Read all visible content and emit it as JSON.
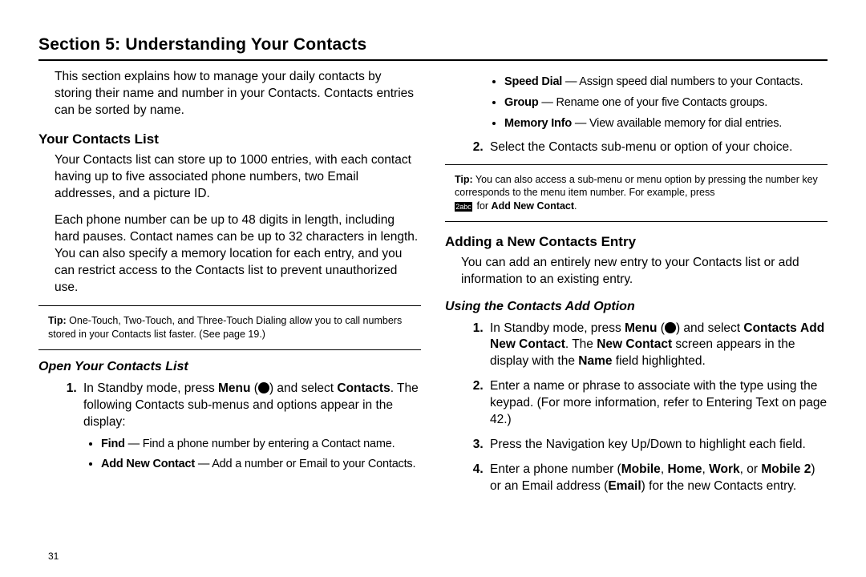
{
  "title": "Section 5: Understanding Your Contacts",
  "page_number": "31",
  "left": {
    "intro": "This section explains how to manage your daily contacts by storing their name and number in your Contacts. Contacts entries can be sorted by name.",
    "h_contacts_list": "Your Contacts List",
    "p1": "Your Contacts list can store up to 1000 entries, with each contact having up to five associated phone numbers, two Email addresses, and a picture ID.",
    "p2": "Each phone number can be up to 48 digits in length, including hard pauses. Contact names can be up to 32 characters in length. You can also specify a memory location for each entry, and you can restrict access to the Contacts list to prevent unauthorized use.",
    "tip_label": "Tip:",
    "tip_body": " One-Touch, Two-Touch, and Three-Touch Dialing allow you to call numbers stored in your Contacts list faster. (See page 19.)",
    "h_open": "Open Your Contacts List",
    "step1_a": "In Standby mode, press ",
    "step1_menu": "Menu",
    "step1_b": " (",
    "step1_c": ") and select ",
    "step1_contacts": "Contacts",
    "step1_d": ". The following Contacts sub-menus and options appear in the display:",
    "bul_find_t": "Find",
    "bul_find_d": " — Find a phone number by entering a Contact name.",
    "bul_add_t": "Add New Contact",
    "bul_add_d": " — Add a number or Email to your Contacts."
  },
  "right": {
    "bul_speed_t": "Speed Dial",
    "bul_speed_d": " — Assign speed dial numbers to your Contacts.",
    "bul_group_t": "Group",
    "bul_group_d": " — Rename one of your five Contacts groups.",
    "bul_mem_t": "Memory Info",
    "bul_mem_d": " — View available memory for dial entries.",
    "step2": "Select the Contacts sub-menu or option of your choice.",
    "tip_label": "Tip:",
    "tip_body_a": " You can also access a sub-menu or menu option by pressing the number key corresponds to the menu item number. For example, press ",
    "tip_key_glyph": "2abc",
    "tip_body_b": " for ",
    "tip_bold": "Add New Contact",
    "tip_body_c": ".",
    "h_adding": "Adding a New Contacts Entry",
    "p_adding": "You can add an entirely new entry to your Contacts list or add information to an existing entry.",
    "h_using": "Using the Contacts Add Option",
    "s1_a": "In Standby mode, press ",
    "s1_menu": "Menu",
    "s1_b": " (",
    "s1_c": ") and select ",
    "s1_contacts": "Contacts",
    "s1_arrow": " ",
    "s1_add": "Add New Contact",
    "s1_d": ". The ",
    "s1_new": "New Contact",
    "s1_e": " screen appears in the display with the ",
    "s1_name": "Name",
    "s1_f": " field highlighted.",
    "s2_a": "Enter a name or phrase to associate with the type using the keypad. (For more information, refer to  ",
    "s2_link": "Entering Text",
    "s2_b": " on page 42.)",
    "s3": "Press the Navigation key Up/Down to highlight each field.",
    "s4_a": "Enter a phone number (",
    "s4_mobile": "Mobile",
    "s4_c1": ", ",
    "s4_home": "Home",
    "s4_c2": ", ",
    "s4_work": "Work",
    "s4_c3": ", or ",
    "s4_mobile2": "Mobile 2",
    "s4_b": ") or an Email address (",
    "s4_email": "Email",
    "s4_c": ") for the new Contacts entry."
  }
}
